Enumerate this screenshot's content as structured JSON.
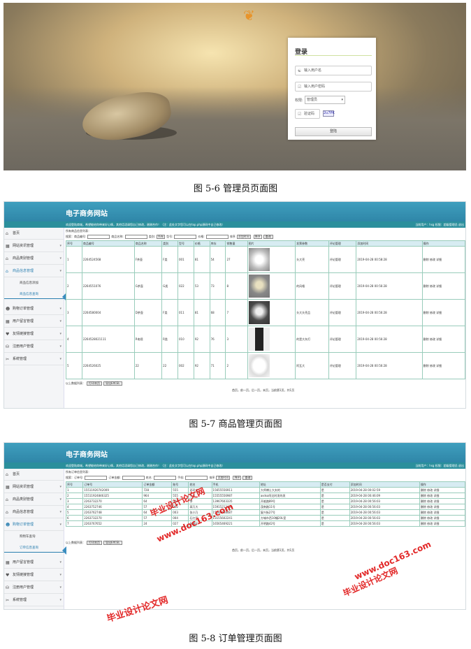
{
  "login": {
    "title": "登录",
    "username_placeholder": "输入用户名",
    "password_placeholder": "输入用户密码",
    "role_label": "权限:",
    "role_selected": "管理员",
    "captcha_placeholder": "验证码",
    "captcha_text": "2u7PK",
    "submit": "登陆"
  },
  "captions": {
    "fig1": "图 5-6 管理员页面图",
    "fig2": "图 5-7 商品管理页面图",
    "fig3": "图 5-8 订单管理页面图"
  },
  "admin": {
    "site_title": "电子商务网站",
    "welcome": "欢迎登陆商城，希望能给你带来好心情，其他话语请您自己修改，谢谢合作！（注：此处文字您可以在top.php源码中自己修改）",
    "user_info": "当前用户：hsg 权限：超级管理员 退出",
    "menu": [
      "首页",
      "网站资讯管理",
      "商品类别管理",
      "商品信息管理",
      "购物订单管理",
      "用户留言管理",
      "友情链接管理",
      "注册用户管理",
      "系统管理"
    ],
    "menu3": [
      "首页",
      "网站资讯管理",
      "商品类别管理",
      "商品信息管理",
      "购物订单管理",
      "用户留言管理",
      "友情链接管理",
      "注册用户管理",
      "系统管理"
    ]
  },
  "products": {
    "heading": "所有商品信息列表：",
    "search": {
      "l1": "搜索：",
      "l2": "商品编号:",
      "l3": "商品名称:",
      "l4": "类别:",
      "all": "所有",
      "l5": "型号:",
      "l6": "价格:",
      "sort": "排序",
      "sort_sel": "添加时间",
      "order_sel": "降序",
      "go": "查询"
    },
    "columns": [
      "序号",
      "商品编号",
      "商品名称",
      "类别",
      "型号",
      "价格",
      "库存",
      "销售量",
      "图片",
      "发票参数",
      "评论管理",
      "添加时间",
      "操作"
    ],
    "rows": [
      {
        "no": "1",
        "code": "2264524568",
        "name": "F茶壶",
        "cat": "F类",
        "model": "001",
        "price": "81",
        "stock": "54",
        "sales": "27",
        "param": "头大壳",
        "comment": "评论管理",
        "time": "2019-04-28 00:58:28",
        "ops": "删除 修改 详细"
      },
      {
        "no": "2",
        "code": "2264551076",
        "name": "G茶壶",
        "cat": "G类",
        "model": "022",
        "price": "53",
        "stock": "73",
        "sales": "8",
        "param": "的风格",
        "comment": "评论管理",
        "time": "2019-04-28 00:56:28",
        "ops": "删除 修改 详细"
      },
      {
        "no": "3",
        "code": "2264580004",
        "name": "D茶壶",
        "cat": "F类",
        "model": "011",
        "price": "81",
        "stock": "68",
        "sales": "7",
        "param": "头大头壳品",
        "comment": "评论管理",
        "time": "2019-04-28 00:56:28",
        "ops": "删除 修改 详细"
      },
      {
        "no": "4",
        "code": "2264528021111",
        "name": "R电视",
        "cat": "R类",
        "model": "010",
        "price": "92",
        "stock": "76",
        "sales": "3",
        "param": "的是大灰灯",
        "comment": "评论管理",
        "time": "2019-04-28 00:56:28",
        "ops": "删除 修改 详细"
      },
      {
        "no": "5",
        "code": "2264526025",
        "name": "22",
        "cat": "22",
        "model": "002",
        "price": "92",
        "stock": "71",
        "sales": "2",
        "param": "阿瓦大",
        "comment": "评论管理",
        "time": "2019-04-28 00:56:28",
        "ops": "删除 修改 详细"
      }
    ],
    "footer": "以上数据列表：",
    "print": "打印本页",
    "export": "导出EXCEL",
    "pager": "首页，前一页，后一页，末页，当前第1页，共1页"
  },
  "orders": {
    "heading": "所有订单信息列表：",
    "search": {
      "l1": "搜索：",
      "l2": "订单号:",
      "l3": "订单金额:",
      "l4": "姓名:",
      "l5": "手机:",
      "sort": "排序",
      "sort_sel": "添加时间",
      "order_sel": "降序",
      "go": "查询"
    },
    "columns": [
      "序号",
      "订单号",
      "订单金额",
      "账号",
      "姓名",
      "手机",
      "地址",
      "是否支付",
      "添加时间",
      "操作"
    ],
    "rows": [
      {
        "no": "1",
        "code": "15511920742009",
        "amt": "728",
        "acct": "555",
        "name": "邓环龙",
        "phone": "15655556911",
        "addr": "大师傅士大夫的",
        "paid": "是",
        "time": "2019-04-28 00:02:59",
        "ops": "删除 修改 详细"
      },
      {
        "no": "2",
        "code": "15511924846325",
        "amt": "964",
        "acct": "555",
        "name": "王五",
        "phone": "15555556987",
        "addr": "asdsa阿达时发的发",
        "paid": "是",
        "time": "2019-04-28 00:46:09",
        "ops": "删除 修改 详细"
      },
      {
        "no": "3",
        "code": "2263732270",
        "amt": "64",
        "acct": "001",
        "name": "李",
        "phone": "13967603335",
        "addr": "开维路89号",
        "paid": "是",
        "time": "2019-04-28 00:56:03",
        "ops": "删除 修改 详细"
      },
      {
        "no": "4",
        "code": "2263752746",
        "amt": "57",
        "acct": "002",
        "name": "高万大",
        "phone": "15915213489",
        "addr": "茂南路11号",
        "paid": "是",
        "time": "2019-04-28 00:56:03",
        "ops": "删除 修改 详细"
      },
      {
        "no": "5",
        "code": "2263762748",
        "amt": "64",
        "acct": "003",
        "name": "张小乃",
        "phone": "15489668487",
        "addr": "复兴街27号",
        "paid": "是",
        "time": "2019-04-28 00:56:03",
        "ops": "删除 修改 详细"
      },
      {
        "no": "6",
        "code": "2263732270",
        "amt": "57",
        "acct": "004",
        "name": "石红军",
        "phone": "13155602241",
        "addr": "方城市西10幢20L室",
        "paid": "是",
        "time": "2019-04-28 00:56:03",
        "ops": "删除 修改 详细"
      },
      {
        "no": "7",
        "code": "2263767652",
        "amt": "24",
        "acct": "027",
        "name": "张屏印",
        "phone": "16565469221",
        "addr": "开明路42号",
        "paid": "是",
        "time": "2019-04-28 00:56:03",
        "ops": "删除 修改 详细"
      }
    ],
    "footer": "以上数据列表：",
    "print": "打印本页",
    "export": "导出EXCEL",
    "pager": "首页，前一页，后一页，末页，当前第1页，共1页",
    "submenu": [
      "购物车查询",
      "订单信息查询"
    ]
  },
  "product_submenu": [
    "商品信息添加",
    "商品信息查询"
  ],
  "watermark": {
    "line1": "毕业设计论文网",
    "line2": "www.doc163.com"
  }
}
